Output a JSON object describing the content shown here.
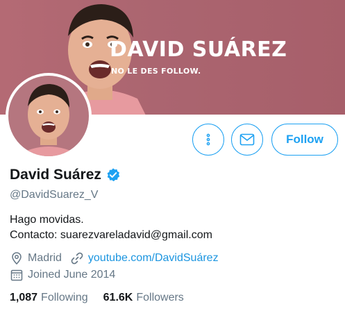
{
  "banner": {
    "title": "DAVID SUÁREZ",
    "subtitle": "NO LE DES FOLLOW."
  },
  "colors": {
    "accent": "#1da1f2",
    "banner_bg": "#ab6570",
    "muted": "#657786"
  },
  "actions": {
    "more_icon": "more-vertical-icon",
    "message_icon": "envelope-icon",
    "follow_label": "Follow"
  },
  "profile": {
    "name": "David Suárez",
    "handle": "@DavidSuarez_V",
    "verified": true,
    "bio_line1": "Hago movidas.",
    "bio_line2": "Contacto: suarezvareladavid@gmail.com",
    "location": "Madrid",
    "website": "youtube.com/DavidSuárez",
    "joined": "Joined June 2014"
  },
  "stats": {
    "following_count": "1,087",
    "following_label": "Following",
    "followers_count": "61.6K",
    "followers_label": "Followers"
  }
}
